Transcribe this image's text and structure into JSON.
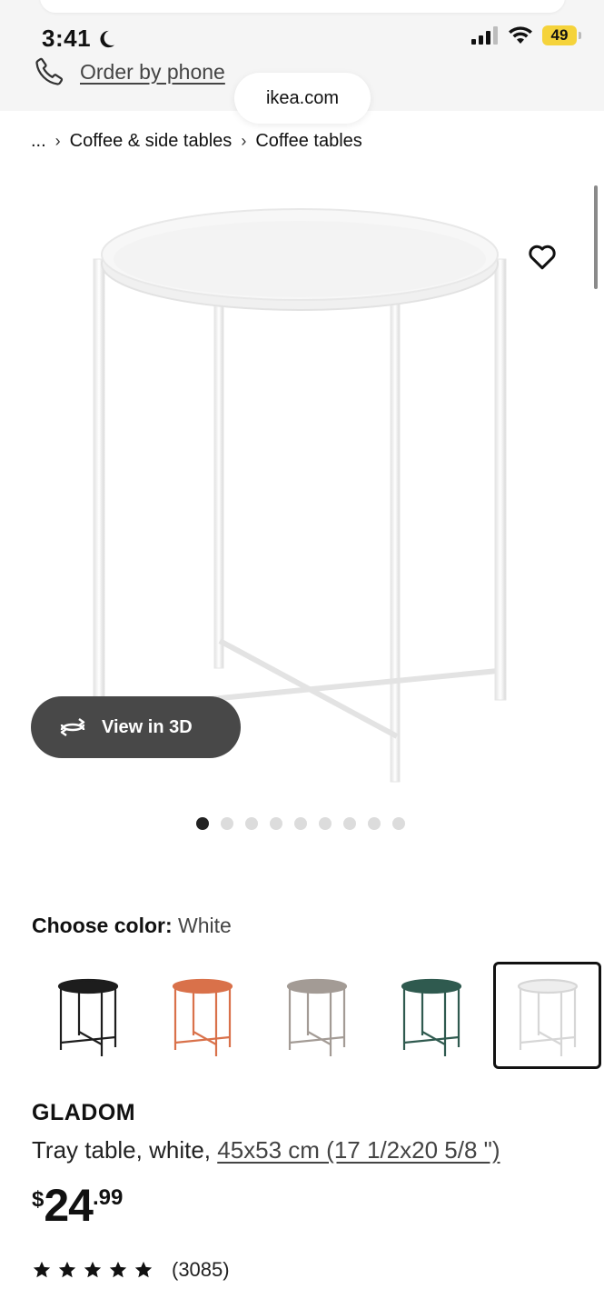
{
  "status_bar": {
    "time": "3:41",
    "battery": "49"
  },
  "header": {
    "order_by_phone": "Order by phone",
    "url": "ikea.com"
  },
  "breadcrumb": {
    "ellipsis": "...",
    "items": [
      "Coffee & side tables",
      "Coffee tables"
    ]
  },
  "gallery": {
    "view_3d_label": "View in 3D",
    "dot_count": 9,
    "active_index": 0
  },
  "color_chooser": {
    "label": "Choose color:",
    "value": "White",
    "swatches": [
      {
        "color": "#1d1d1d"
      },
      {
        "color": "#d9714a"
      },
      {
        "color": "#a39b95"
      },
      {
        "color": "#2f5a4f"
      },
      {
        "color": "#e4e4e4",
        "selected": true
      }
    ]
  },
  "product": {
    "name": "GLADOM",
    "description": "Tray table, white, ",
    "dimensions": "45x53 cm (17 1/2x20 5/8 \")",
    "price_currency": "$",
    "price_integer": "24",
    "price_decimal": ".99",
    "rating": 5,
    "review_count": "(3085)"
  }
}
